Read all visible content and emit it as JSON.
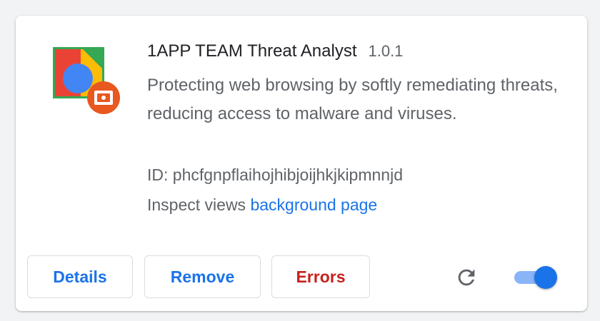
{
  "extension": {
    "name": "1APP TEAM Threat Analyst",
    "version": "1.0.1",
    "description": "Protecting web browsing by softly remediating threats, reducing access to malware and viruses.",
    "id_label": "ID: ",
    "id_value": "phcfgnpflaihojhibjoijhkjkipmnnjd",
    "inspect_label": "Inspect views ",
    "inspect_link": "background page",
    "enabled": true
  },
  "buttons": {
    "details": "Details",
    "remove": "Remove",
    "errors": "Errors"
  },
  "icons": {
    "extension": "extension-logo-icon",
    "badge": "camera-badge-icon",
    "reload": "reload-icon"
  },
  "colors": {
    "link": "#1a73e8",
    "error": "#c5221f",
    "toggle_track": "#8ab4f8",
    "toggle_knob": "#1a73e8"
  }
}
